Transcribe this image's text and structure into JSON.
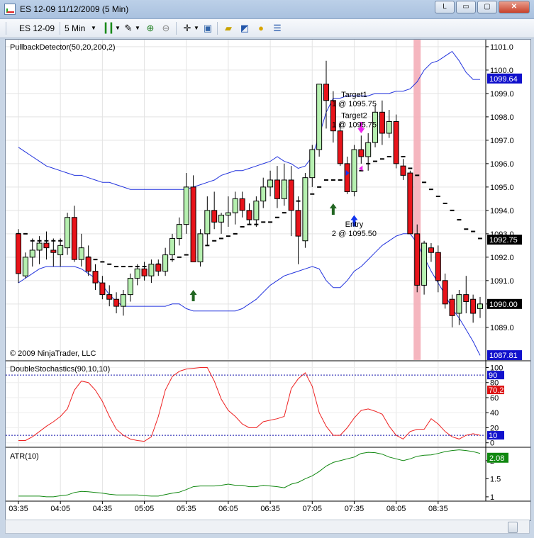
{
  "window": {
    "title": "ES 12-09  11/12/2009 (5 Min)",
    "buttons": [
      "L",
      "▭",
      "▢",
      "✕"
    ]
  },
  "toolbar": {
    "instrument": "ES 12-09",
    "interval": "5 Min",
    "icons": [
      "candlestick-icon",
      "pencil-icon",
      "zoom-in-icon",
      "zoom-out-icon",
      "crosshair-icon",
      "properties-icon",
      "folder-icon",
      "chart-icon",
      "dollar-icon",
      "list-icon"
    ]
  },
  "colors": {
    "up_candle": "#b6f0b0",
    "down_candle": "#e8131a",
    "band": "#2233dd",
    "stochastic": "#ee2222",
    "atr": "#118811",
    "highlight": "#f4aeb8"
  },
  "chart_data": [
    {
      "type": "candlestick",
      "title": "PullbackDetector(50,20,200,2)",
      "copyright": "© 2009 NinjaTrader, LLC",
      "x_tick_labels": [
        "03:35",
        "04:05",
        "04:35",
        "05:05",
        "05:35",
        "06:05",
        "06:35",
        "07:05",
        "07:35",
        "08:05",
        "08:35"
      ],
      "ylim": [
        1087.6,
        1101.3
      ],
      "y_ticks": [
        1089.0,
        1090.0,
        1091.0,
        1092.0,
        1093.0,
        1094.0,
        1095.0,
        1096.0,
        1097.0,
        1098.0,
        1099.0,
        1100.0,
        1101.0
      ],
      "price_labels": [
        {
          "text": "1099.64",
          "value": 1099.64,
          "color": "#1111cc"
        },
        {
          "text": "1092.75",
          "value": 1092.75,
          "color": "#000000"
        },
        {
          "text": "1090.00",
          "value": 1090.0,
          "color": "#000000"
        },
        {
          "text": "1087.81",
          "value": 1087.81,
          "color": "#1111cc"
        }
      ],
      "ohlc": [
        [
          1093.0,
          1093.2,
          1090.9,
          1091.3
        ],
        [
          1091.2,
          1092.2,
          1091.1,
          1092.0
        ],
        [
          1092.0,
          1092.8,
          1091.6,
          1092.3
        ],
        [
          1092.3,
          1092.9,
          1091.7,
          1092.6
        ],
        [
          1092.6,
          1093.1,
          1091.9,
          1092.4
        ],
        [
          1092.3,
          1092.8,
          1091.6,
          1092.2
        ],
        [
          1092.1,
          1092.8,
          1091.6,
          1092.5
        ],
        [
          1092.4,
          1093.9,
          1092.1,
          1093.7
        ],
        [
          1093.7,
          1094.2,
          1091.8,
          1091.9
        ],
        [
          1091.9,
          1093.0,
          1091.6,
          1092.4
        ],
        [
          1092.0,
          1092.5,
          1091.2,
          1091.4
        ],
        [
          1091.4,
          1091.7,
          1090.6,
          1090.9
        ],
        [
          1090.9,
          1091.2,
          1090.2,
          1090.4
        ],
        [
          1090.4,
          1090.8,
          1089.9,
          1090.2
        ],
        [
          1090.2,
          1090.5,
          1089.6,
          1089.9
        ],
        [
          1089.9,
          1090.6,
          1089.5,
          1090.4
        ],
        [
          1090.4,
          1091.3,
          1090.1,
          1091.1
        ],
        [
          1091.1,
          1091.7,
          1090.8,
          1091.5
        ],
        [
          1091.5,
          1091.8,
          1091.0,
          1091.2
        ],
        [
          1091.2,
          1091.9,
          1090.9,
          1091.7
        ],
        [
          1091.7,
          1091.9,
          1091.2,
          1091.4
        ],
        [
          1091.4,
          1092.4,
          1091.2,
          1092.1
        ],
        [
          1092.1,
          1093.0,
          1091.8,
          1092.8
        ],
        [
          1092.8,
          1093.7,
          1092.5,
          1093.4
        ],
        [
          1093.4,
          1095.6,
          1093.0,
          1095.0
        ],
        [
          1095.0,
          1095.5,
          1091.8,
          1091.8
        ],
        [
          1091.8,
          1093.2,
          1091.6,
          1093.0
        ],
        [
          1093.0,
          1094.6,
          1092.5,
          1094.0
        ],
        [
          1094.0,
          1094.8,
          1093.2,
          1093.5
        ],
        [
          1093.5,
          1093.9,
          1093.0,
          1093.8
        ],
        [
          1093.8,
          1094.6,
          1093.3,
          1093.9
        ],
        [
          1093.9,
          1094.8,
          1093.4,
          1094.5
        ],
        [
          1094.5,
          1094.8,
          1093.7,
          1094.0
        ],
        [
          1094.0,
          1094.3,
          1093.4,
          1093.6
        ],
        [
          1093.6,
          1094.6,
          1093.3,
          1094.4
        ],
        [
          1094.4,
          1095.4,
          1094.1,
          1095.0
        ],
        [
          1095.0,
          1095.7,
          1094.6,
          1095.3
        ],
        [
          1095.3,
          1095.9,
          1094.1,
          1094.5
        ],
        [
          1094.5,
          1096.0,
          1094.2,
          1095.3
        ],
        [
          1095.3,
          1095.9,
          1092.9,
          1094.0
        ],
        [
          1094.0,
          1094.6,
          1091.7,
          1092.9
        ],
        [
          1092.7,
          1095.6,
          1092.4,
          1095.4
        ],
        [
          1095.4,
          1096.8,
          1095.0,
          1096.6
        ],
        [
          1096.6,
          1099.4,
          1096.3,
          1099.4
        ],
        [
          1099.4,
          1100.4,
          1097.5,
          1098.7
        ],
        [
          1098.7,
          1099.1,
          1096.9,
          1097.4
        ],
        [
          1097.4,
          1097.8,
          1095.9,
          1096.0
        ],
        [
          1096.0,
          1096.3,
          1094.7,
          1094.8
        ],
        [
          1094.8,
          1096.8,
          1094.6,
          1096.6
        ],
        [
          1096.6,
          1097.2,
          1096.0,
          1096.3
        ],
        [
          1096.3,
          1097.3,
          1095.7,
          1096.9
        ],
        [
          1096.9,
          1098.5,
          1096.7,
          1098.2
        ],
        [
          1098.2,
          1098.7,
          1096.8,
          1097.3
        ],
        [
          1097.3,
          1098.3,
          1097.1,
          1097.8
        ],
        [
          1097.8,
          1098.1,
          1095.8,
          1096.0
        ],
        [
          1095.9,
          1096.2,
          1095.3,
          1095.5
        ],
        [
          1095.6,
          1095.7,
          1093.1,
          1093.0
        ],
        [
          1093.0,
          1093.4,
          1090.5,
          1090.8
        ],
        [
          1090.8,
          1092.7,
          1090.4,
          1092.6
        ],
        [
          1092.4,
          1092.6,
          1091.8,
          1092.2
        ],
        [
          1092.2,
          1092.5,
          1090.5,
          1091.0
        ],
        [
          1091.0,
          1091.3,
          1089.8,
          1090.0
        ],
        [
          1090.2,
          1090.4,
          1089.0,
          1089.5
        ],
        [
          1089.6,
          1090.6,
          1089.1,
          1090.4
        ],
        [
          1090.4,
          1091.2,
          1089.6,
          1090.1
        ],
        [
          1090.2,
          1090.4,
          1089.2,
          1089.6
        ],
        [
          1089.8,
          1090.3,
          1089.4,
          1090.0
        ]
      ],
      "upper_band": [
        1096.7,
        1096.5,
        1096.3,
        1096.1,
        1095.9,
        1095.8,
        1095.7,
        1095.6,
        1095.5,
        1095.5,
        1095.4,
        1095.3,
        1095.2,
        1095.2,
        1095.1,
        1095.0,
        1094.9,
        1094.9,
        1094.9,
        1094.9,
        1094.9,
        1094.9,
        1094.9,
        1094.9,
        1094.9,
        1095.0,
        1095.1,
        1095.2,
        1095.3,
        1095.5,
        1095.6,
        1095.7,
        1095.7,
        1095.8,
        1095.9,
        1096.0,
        1096.1,
        1096.3,
        1096.1,
        1096.0,
        1095.8,
        1095.9,
        1096.3,
        1097.2,
        1098.2,
        1098.8,
        1098.8,
        1098.9,
        1098.9,
        1098.9,
        1098.9,
        1099.0,
        1099.0,
        1099.0,
        1099.1,
        1099.1,
        1099.2,
        1099.5,
        1100.0,
        1100.3,
        1100.4,
        1100.6,
        1100.8,
        1100.4,
        1099.9,
        1099.6,
        1099.6
      ],
      "lower_band": [
        1090.9,
        1091.1,
        1091.3,
        1091.5,
        1091.6,
        1091.6,
        1091.6,
        1091.6,
        1091.6,
        1091.5,
        1091.3,
        1091.1,
        1090.8,
        1090.4,
        1090.1,
        1089.9,
        1089.9,
        1089.9,
        1089.9,
        1089.9,
        1089.9,
        1089.9,
        1090.0,
        1090.0,
        1089.8,
        1089.7,
        1089.7,
        1089.7,
        1089.7,
        1089.7,
        1089.7,
        1089.7,
        1089.8,
        1090.0,
        1090.2,
        1090.5,
        1090.8,
        1091.0,
        1091.2,
        1091.3,
        1091.4,
        1091.5,
        1091.6,
        1091.5,
        1091.0,
        1090.7,
        1090.7,
        1091.0,
        1091.4,
        1091.6,
        1091.9,
        1092.2,
        1092.5,
        1092.7,
        1092.9,
        1093.0,
        1093.0,
        1092.6,
        1092.0,
        1091.4,
        1090.9,
        1090.4,
        1089.8,
        1089.4,
        1088.9,
        1088.4,
        1087.8
      ],
      "trail_dashes": [
        1093.0,
        1093.0,
        1092.7,
        1092.7,
        1092.7,
        1092.7,
        1092.7,
        1092.7,
        1092.5,
        1092.3,
        1092.0,
        1091.9,
        1091.8,
        1091.7,
        1091.6,
        1091.6,
        1091.6,
        1091.6,
        1091.6,
        1091.6,
        1091.7,
        1091.8,
        1091.9,
        1092.0,
        1092.1,
        1092.2,
        1092.4,
        1092.5,
        1092.7,
        1092.8,
        1092.9,
        1093.0,
        1093.3,
        1093.4,
        1093.4,
        1093.5,
        1093.5,
        1093.7,
        1093.9,
        1094.2,
        1094.4,
        1094.6,
        1094.7,
        1095.0,
        1095.3,
        1095.3,
        1095.3,
        1095.3,
        1095.5,
        1095.7,
        1096.0,
        1096.1,
        1096.2,
        1096.3,
        1096.3,
        1096.3,
        1095.8,
        1095.5,
        1095.2,
        1094.9,
        1094.6,
        1094.3,
        1094.0,
        1093.6,
        1093.2,
        1093.1,
        1092.8
      ],
      "highlight_bar_index": 57,
      "annotations": [
        {
          "kind": "arrow-up",
          "bar": 25,
          "price": 1090.6,
          "color": "#226622"
        },
        {
          "kind": "arrow-up",
          "bar": 45,
          "price": 1094.3,
          "color": "#226622"
        },
        {
          "kind": "arrow-up",
          "bar": 48,
          "price": 1093.8,
          "color": "#1133ee"
        },
        {
          "kind": "arrow-down",
          "bar": 49,
          "price": 1097.3,
          "color": "#ee22ee"
        },
        {
          "kind": "tri-left",
          "bar": 49,
          "price": 1095.8,
          "color": "#ee22ee"
        },
        {
          "kind": "tri-right",
          "bar": 47,
          "price": 1095.6,
          "color": "#1133ee"
        }
      ],
      "texts": [
        {
          "name": "target1-label",
          "text": "Target1",
          "bar": 48,
          "price": 1098.85
        },
        {
          "name": "target1-qty",
          "text": "1 @ 1095.75",
          "bar": 48,
          "price": 1098.45
        },
        {
          "name": "target2-label",
          "text": "Target2",
          "bar": 48,
          "price": 1097.95
        },
        {
          "name": "target2-qty",
          "text": "1 @ 1095.75",
          "bar": 48,
          "price": 1097.55
        },
        {
          "name": "entry-label",
          "text": "Entry",
          "bar": 48,
          "price": 1093.3
        },
        {
          "name": "entry-qty",
          "text": "2 @ 1095.50",
          "bar": 48,
          "price": 1092.9
        }
      ]
    },
    {
      "type": "line",
      "title": "DoubleStochastics(90,10,10)",
      "ylim": [
        -5,
        108
      ],
      "y_ticks": [
        0,
        20,
        40,
        60,
        80,
        100
      ],
      "reference_lines": [
        90,
        10
      ],
      "value_labels": [
        {
          "text": "90",
          "value": 90,
          "color": "#1111cc"
        },
        {
          "text": "70.26",
          "value": 70.26,
          "color": "#dd1111"
        },
        {
          "text": "10",
          "value": 10,
          "color": "#1111cc"
        }
      ],
      "values": [
        3,
        3,
        8,
        15,
        22,
        28,
        35,
        45,
        70,
        82,
        80,
        70,
        55,
        35,
        18,
        10,
        5,
        3,
        2,
        8,
        35,
        70,
        88,
        95,
        98,
        99,
        100,
        100,
        82,
        58,
        43,
        35,
        25,
        20,
        20,
        28,
        30,
        32,
        35,
        72,
        85,
        93,
        75,
        40,
        22,
        10,
        10,
        20,
        33,
        43,
        45,
        42,
        38,
        22,
        10,
        5,
        15,
        18,
        18,
        32,
        25,
        15,
        8,
        5,
        10,
        12,
        10
      ],
      "color": "#ee2222"
    },
    {
      "type": "line",
      "title": "ATR(10)",
      "ylim": [
        0.9,
        2.35
      ],
      "y_ticks": [
        1,
        1.5,
        2
      ],
      "value_labels": [
        {
          "text": "2.08",
          "value": 2.08,
          "color": "#118811"
        }
      ],
      "values": [
        1.02,
        1.02,
        1.02,
        1.02,
        1.0,
        1.0,
        1.03,
        1.05,
        1.12,
        1.15,
        1.14,
        1.12,
        1.1,
        1.07,
        1.05,
        1.05,
        1.05,
        1.05,
        1.03,
        1.02,
        1.02,
        1.06,
        1.1,
        1.13,
        1.2,
        1.28,
        1.3,
        1.3,
        1.3,
        1.32,
        1.35,
        1.32,
        1.32,
        1.28,
        1.28,
        1.32,
        1.3,
        1.28,
        1.25,
        1.35,
        1.4,
        1.5,
        1.58,
        1.7,
        1.85,
        1.95,
        2.0,
        2.05,
        2.1,
        2.2,
        2.23,
        2.22,
        2.18,
        2.1,
        2.05,
        2.0,
        2.05,
        2.12,
        2.15,
        2.16,
        2.2,
        2.25,
        2.28,
        2.3,
        2.28,
        2.25,
        2.2
      ],
      "color": "#118811"
    }
  ]
}
